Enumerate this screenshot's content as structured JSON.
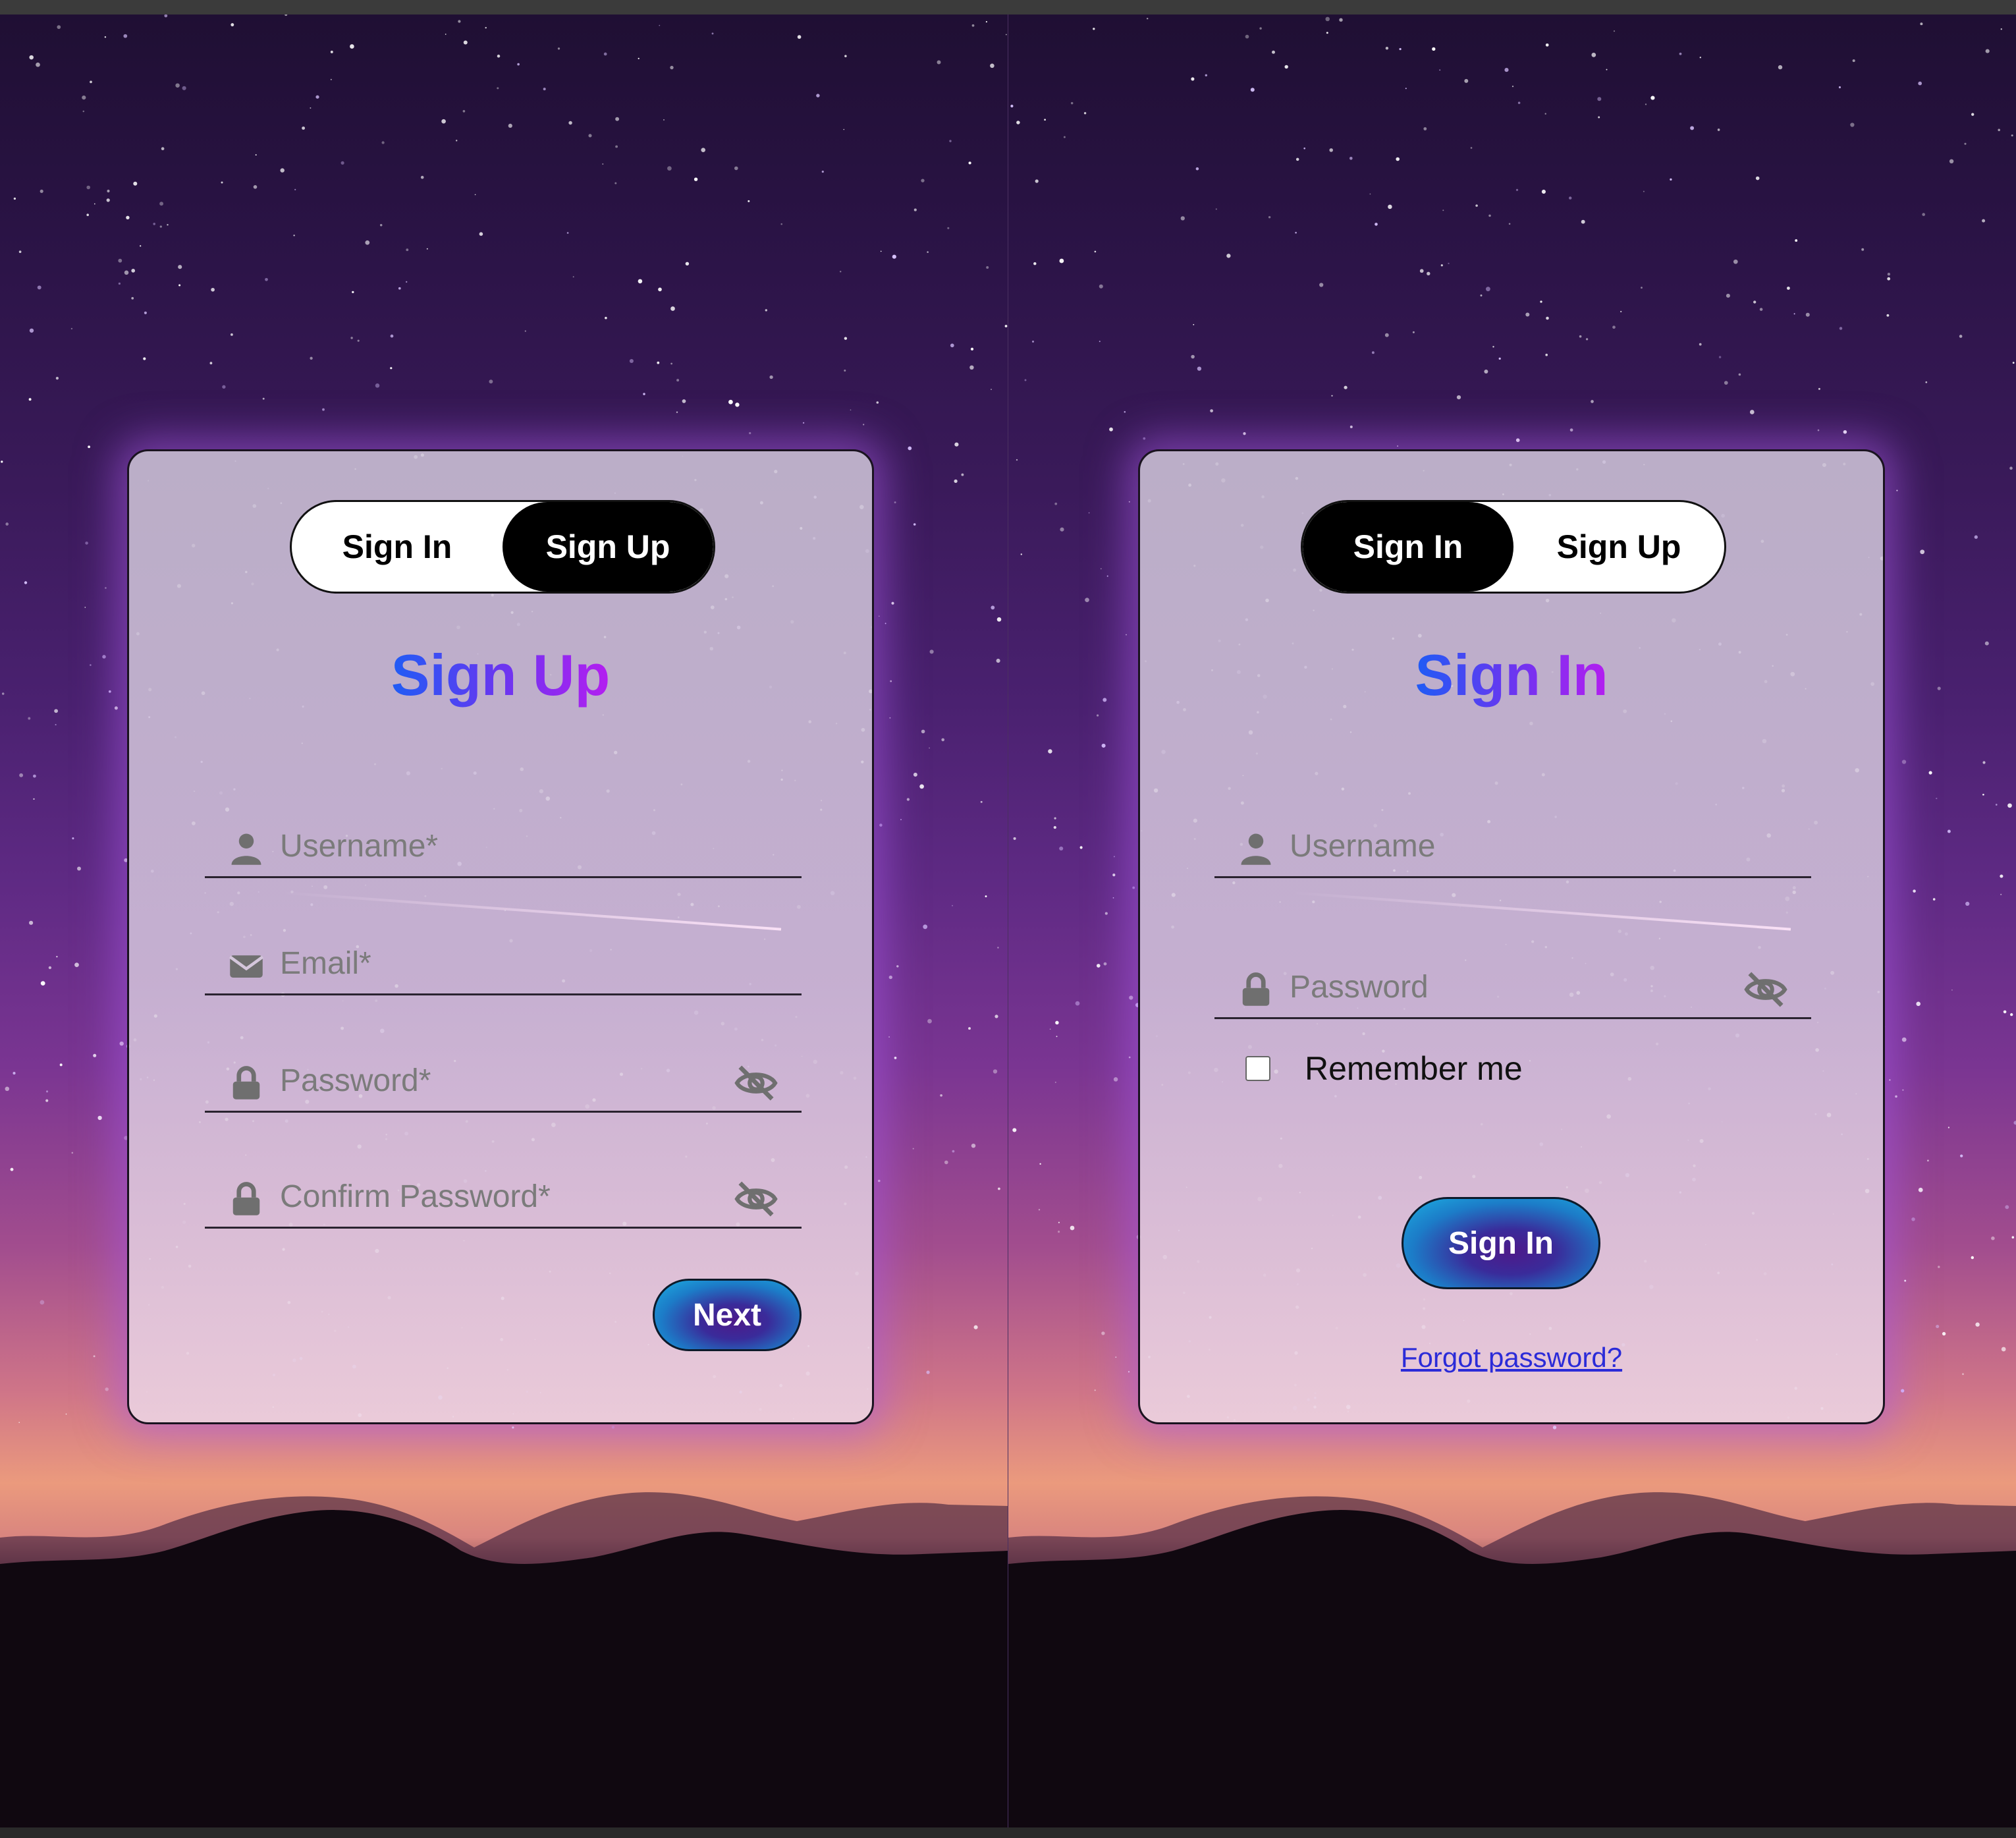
{
  "signup": {
    "toggle": {
      "sign_in": "Sign In",
      "sign_up": "Sign Up",
      "active": "Sign Up"
    },
    "title": "Sign Up",
    "fields": {
      "username_placeholder": "Username*",
      "email_placeholder": "Email*",
      "password_placeholder": "Password*",
      "confirm_placeholder": "Confirm Password*"
    },
    "next_label": "Next"
  },
  "signin": {
    "toggle": {
      "sign_in": "Sign In",
      "sign_up": "Sign Up",
      "active": "Sign In"
    },
    "title": "Sign In",
    "fields": {
      "username_placeholder": "Username",
      "password_placeholder": "Password"
    },
    "remember_label": "Remember me",
    "submit_label": "Sign In",
    "forgot_label": "Forgot password?"
  },
  "icons": {
    "user": "user-icon",
    "email": "envelope-icon",
    "lock": "lock-icon",
    "eye": "eye-slash-icon"
  },
  "colors": {
    "title_gradient_start": "#1f5cf5",
    "title_gradient_end": "#b41ef0",
    "button_gradient_outer": "#1cb0e2",
    "button_gradient_inner": "#4d1a8a",
    "link": "#2b2bd8"
  }
}
